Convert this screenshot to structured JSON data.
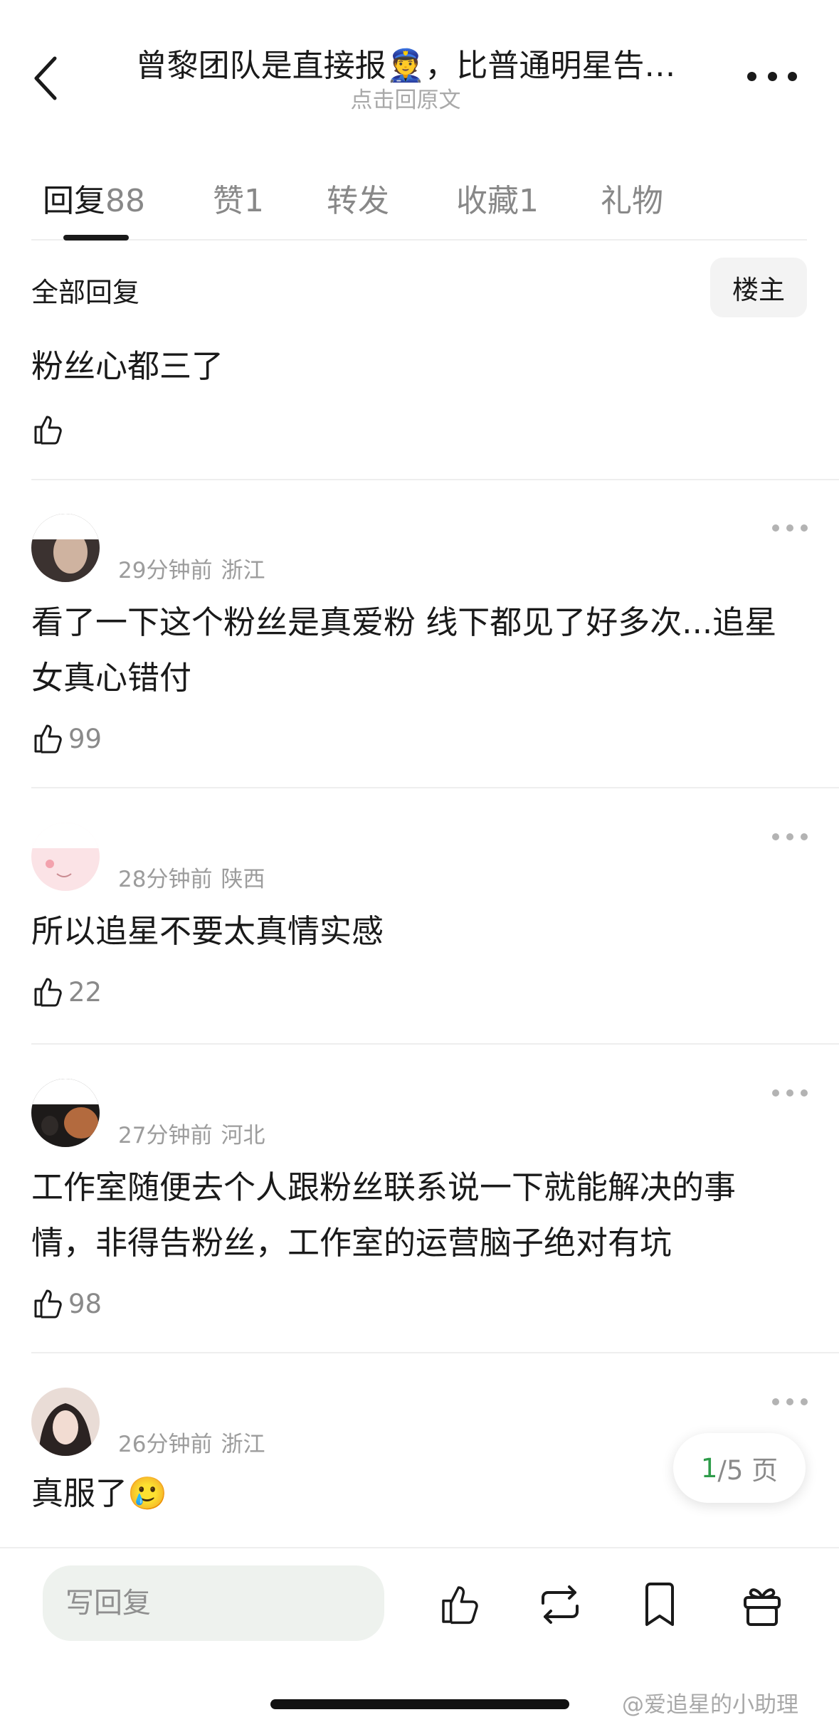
{
  "header": {
    "title": "曾黎团队是直接报👮，比普通明星告…",
    "subtitle": "点击回原文"
  },
  "tabs": [
    {
      "label": "回复",
      "count": "88"
    },
    {
      "label": "赞",
      "count": "1"
    },
    {
      "label": "转发",
      "count": ""
    },
    {
      "label": "收藏",
      "count": "1"
    },
    {
      "label": "礼物",
      "count": ""
    }
  ],
  "filter": {
    "label": "全部回复",
    "owner_button": "楼主"
  },
  "comments": [
    {
      "time": "",
      "location": "",
      "text": "粉丝心都三了",
      "likes": ""
    },
    {
      "time": "29分钟前",
      "location": "浙江",
      "text": "看了一下这个粉丝是真爱粉 线下都见了好多次...追星女真心错付",
      "likes": "99"
    },
    {
      "time": "28分钟前",
      "location": "陕西",
      "text": "所以追星不要太真情实感",
      "likes": "22"
    },
    {
      "time": "27分钟前",
      "location": "河北",
      "text": "工作室随便去个人跟粉丝联系说一下就能解决的事情，非得告粉丝，工作室的运营脑子绝对有坑",
      "likes": "98"
    },
    {
      "time": "26分钟前",
      "location": "浙江",
      "text": "真服了🥲",
      "likes": ""
    }
  ],
  "page_indicator": {
    "current": "1",
    "total": "/5 页"
  },
  "bottom_bar": {
    "reply_placeholder": "写回复"
  },
  "watermark": "@爱追星的小助理",
  "colors": {
    "accent_green": "#2e9c4a",
    "text": "#1a1a1a",
    "muted": "#9c9c9c"
  },
  "icons": [
    "back-arrow-icon",
    "more-icon",
    "thumbs-up-icon",
    "repost-icon",
    "bookmark-icon",
    "gift-icon"
  ]
}
